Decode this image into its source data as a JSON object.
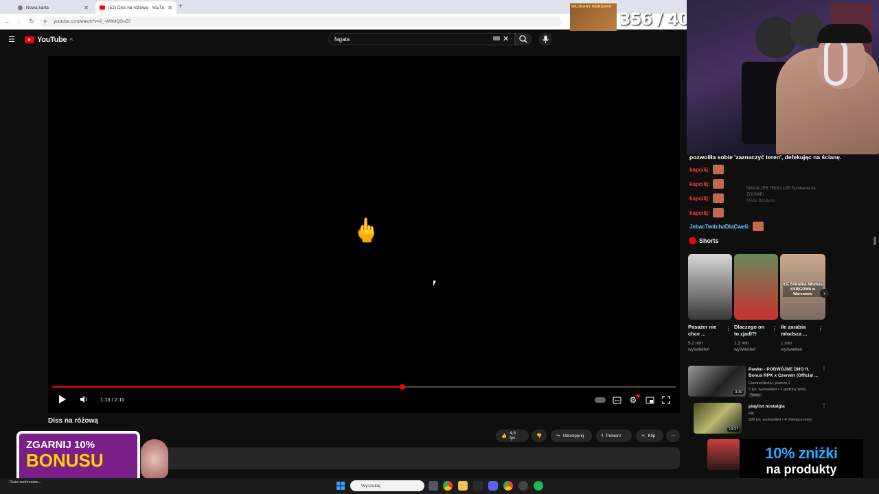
{
  "browser": {
    "tabs": [
      {
        "label": "Nowa karta"
      },
      {
        "label": "(52) Diss na różową - YouTu..."
      }
    ],
    "url": "youtube.com/watch?v=6_-W8MQGoZ0"
  },
  "youtube": {
    "logo_text": "YouTube",
    "country": "PL",
    "search_value": "fagata"
  },
  "player": {
    "emoji": "🖕",
    "time": "1:13 / 2:10",
    "progress": 0.5616
  },
  "video": {
    "title": "Diss na różową",
    "actions": {
      "like": "4,5 tys.",
      "share": "Udostępnij",
      "download": "Pobierz",
      "clip": "Klip"
    }
  },
  "stream": {
    "counter": "356 / 400",
    "thumbcard_text": "WŁODARY WERSARA",
    "chat_header": "pozwoliła sobie 'zaznaczyć teren', defekując na ścianę.",
    "chat": [
      {
        "user": "kapcilij:"
      },
      {
        "user": "kapcilij:"
      },
      {
        "user": "kapcilij:"
      },
      {
        "user": "kapcilij:"
      },
      {
        "user": "JebacTwitchaDlaCweli:"
      }
    ],
    "promo_line1": "10% zniżki",
    "promo_line2": "na produkty",
    "bonus_line1": "ZGARNIJ 10%",
    "bonus_line2": "BONUSU"
  },
  "sidebar": {
    "faded": [
      {
        "title": "MAKALJER TROLLUJE Spotkania na ZOOMIE!",
        "meta": "Mikita Bandycki"
      }
    ],
    "shorts_label": "Shorts",
    "shorts": [
      {
        "title": "Pasażer nie chce ...",
        "views": "5,2 mln wyświetleń"
      },
      {
        "title": "Dlaczego on to zjadł?!",
        "views": "1,2 mln wyświetleń"
      },
      {
        "title": "Ile zarabia młodsza ...",
        "views": "1 mln wyświetleń"
      }
    ],
    "short_overlay": "ILE ZARABIA Młodsza KSIĘGOWA w Warszawie",
    "recommended": [
      {
        "title": "Pawko - PODWÓJNE DNO ft. Bonus RPK x Czerwin (Official ...",
        "channel": "CiemnaStrefa i jeszcze 2",
        "meta": "5 tys. wyświetleń • 2 godziny temu",
        "badge": "Nowy",
        "duration": "3:30"
      },
      {
        "title": "playlist nostalgia",
        "channel": "Rik",
        "meta": "586 tys. wyświetleń • 4 miesiące temu",
        "badge": "",
        "duration": "14:37"
      }
    ]
  },
  "taskbar": {
    "weather": "Duże zachmurze...",
    "search_placeholder": "Wyszukaj"
  },
  "colors": {
    "accent": "#ff0000",
    "background": "#0f0f0f",
    "chat_user": "#ff3b30",
    "promo_blue": "#2aa8ff"
  }
}
